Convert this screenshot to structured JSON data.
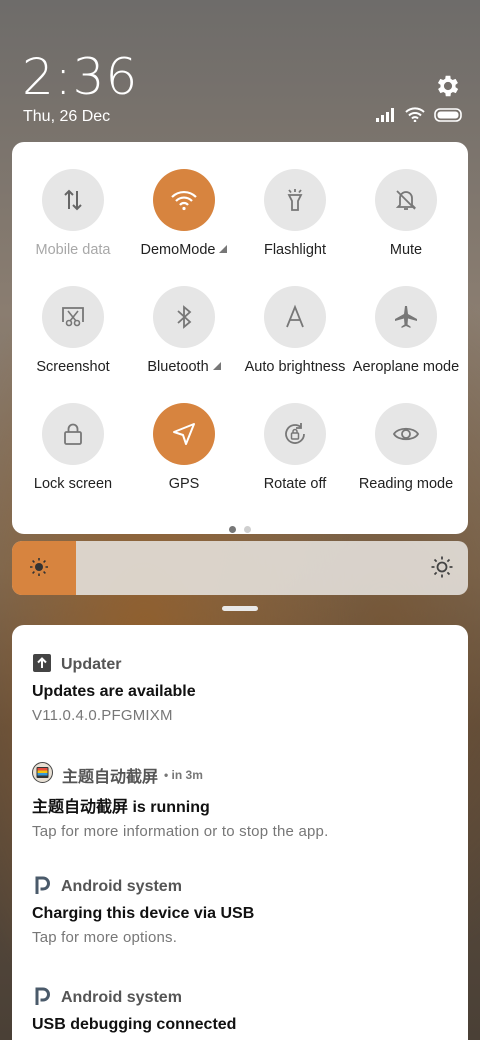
{
  "status": {
    "time": "2:36",
    "date": "Thu, 26 Dec",
    "icons": [
      "signal-icon",
      "wifi-icon",
      "battery-icon",
      "settings-gear-icon"
    ]
  },
  "quick_settings": {
    "tiles": [
      {
        "label": "Mobile data",
        "icon": "mobile-data-icon",
        "active": false,
        "dimmed": true,
        "has_menu": false
      },
      {
        "label": "DemoMode",
        "icon": "wifi-icon",
        "active": true,
        "dimmed": false,
        "has_menu": true
      },
      {
        "label": "Flashlight",
        "icon": "flashlight-icon",
        "active": false,
        "dimmed": false,
        "has_menu": false
      },
      {
        "label": "Mute",
        "icon": "mute-bell-icon",
        "active": false,
        "dimmed": false,
        "has_menu": false
      },
      {
        "label": "Screenshot",
        "icon": "screenshot-icon",
        "active": false,
        "dimmed": false,
        "has_menu": false
      },
      {
        "label": "Bluetooth",
        "icon": "bluetooth-icon",
        "active": false,
        "dimmed": false,
        "has_menu": true
      },
      {
        "label": "Auto brightness",
        "icon": "auto-brightness-icon",
        "active": false,
        "dimmed": false,
        "has_menu": false
      },
      {
        "label": "Aeroplane mode",
        "icon": "airplane-icon",
        "active": false,
        "dimmed": false,
        "has_menu": false
      },
      {
        "label": "Lock screen",
        "icon": "lock-icon",
        "active": false,
        "dimmed": false,
        "has_menu": false
      },
      {
        "label": "GPS",
        "icon": "location-arrow-icon",
        "active": true,
        "dimmed": false,
        "has_menu": false
      },
      {
        "label": "Rotate off",
        "icon": "rotate-lock-icon",
        "active": false,
        "dimmed": false,
        "has_menu": false
      },
      {
        "label": "Reading mode",
        "icon": "eye-icon",
        "active": false,
        "dimmed": false,
        "has_menu": false
      }
    ],
    "page_count": 2,
    "current_page": 1
  },
  "brightness": {
    "level": 0.14,
    "accent": "#d7843f"
  },
  "notifications": [
    {
      "app": "Updater",
      "time": "",
      "icon": "updater-arrow-icon",
      "title": "Updates are available",
      "body": "V11.0.4.0.PFGMIXM"
    },
    {
      "app": "主题自动截屏",
      "time": "• in 3m",
      "icon": "theme-screenshot-app-icon",
      "title": "主题自动截屏 is running",
      "body": "Tap for more information or to stop the app."
    },
    {
      "app": "Android system",
      "time": "",
      "icon": "android-system-icon",
      "title": "Charging this device via USB",
      "body": "Tap for more options."
    },
    {
      "app": "Android system",
      "time": "",
      "icon": "android-system-icon",
      "title": "USB debugging connected",
      "body": ""
    }
  ],
  "colors": {
    "accent": "#d7843f",
    "tile_off": "#e6e6e6"
  }
}
